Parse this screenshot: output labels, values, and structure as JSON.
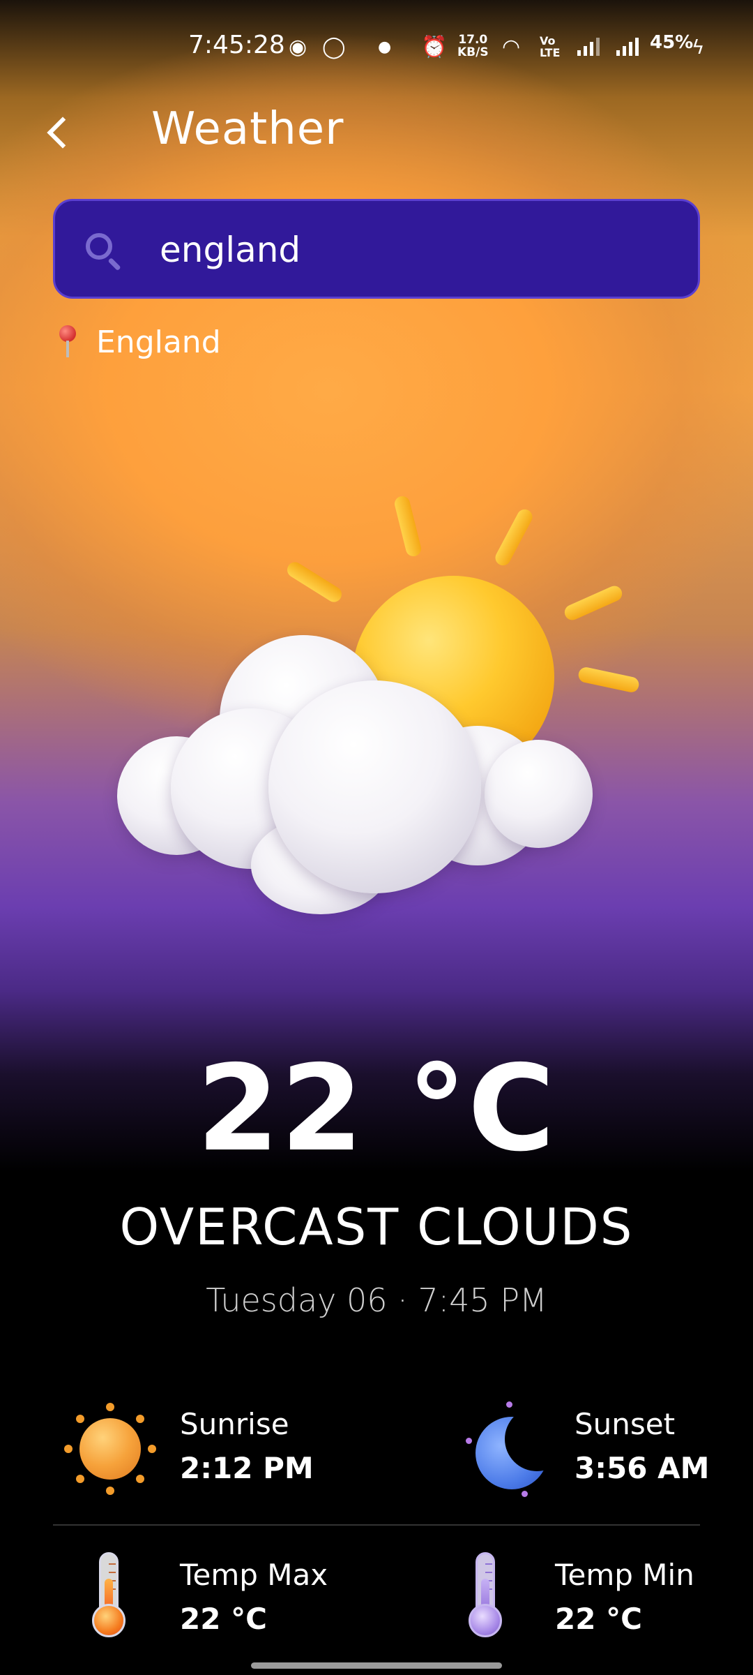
{
  "status_bar": {
    "time": "7:45:28",
    "net_speed": "17.0",
    "net_unit": "KB/S",
    "volte_top": "Vo",
    "volte_bottom": "LTE",
    "battery": "45%"
  },
  "header": {
    "title": "Weather",
    "back_icon": "chevron-left-icon"
  },
  "search": {
    "value": "england",
    "icon": "search-icon"
  },
  "location": {
    "name": "England",
    "icon": "map-pin-icon"
  },
  "weather": {
    "temperature": "22 °C",
    "condition": "OVERCAST CLOUDS",
    "datetime": "Tuesday 06 · 7:45 PM",
    "illustration": "sun-behind-cloud-icon"
  },
  "stats": {
    "sunrise": {
      "label": "Sunrise",
      "value": "2:12 PM",
      "icon": "sunrise-sun-icon"
    },
    "sunset": {
      "label": "Sunset",
      "value": "3:56 AM",
      "icon": "moon-icon"
    },
    "temp_max": {
      "label": "Temp Max",
      "value": "22 °C",
      "icon": "thermometer-hot-icon"
    },
    "temp_min": {
      "label": "Temp Min",
      "value": "22 °C",
      "icon": "thermometer-cold-icon"
    }
  },
  "colors": {
    "search_bg": "#31199a",
    "bg_top": "#f3a345",
    "bg_mid": "#6b3eb0",
    "bg_bottom": "#000000"
  }
}
